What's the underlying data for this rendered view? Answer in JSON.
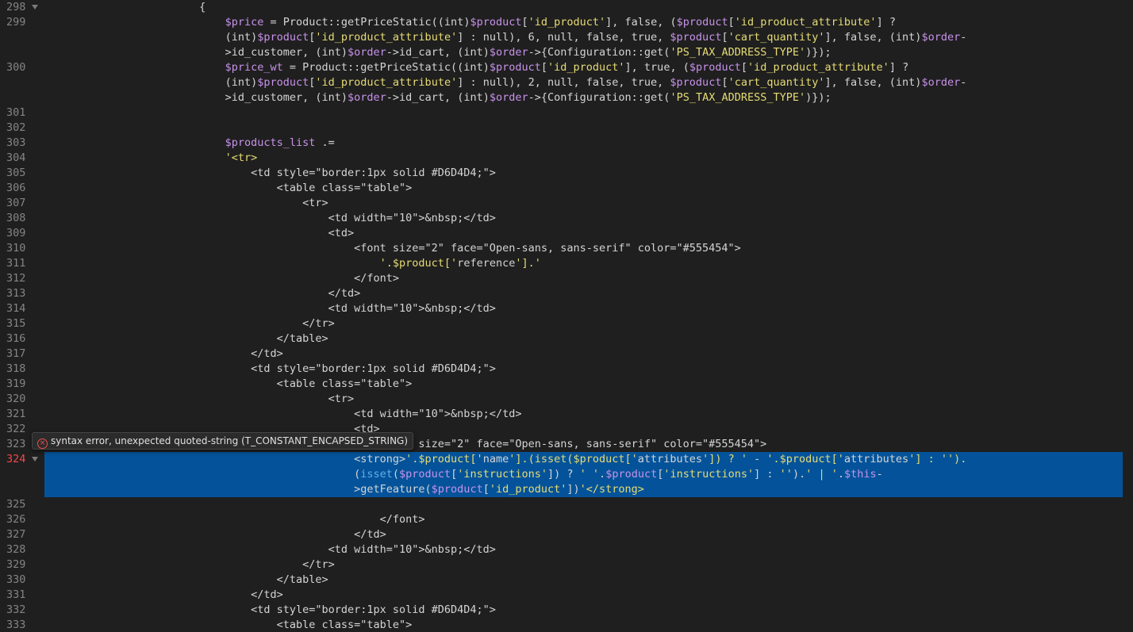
{
  "tooltip": {
    "icon": "error-circle-icon",
    "message": "syntax error, unexpected quoted-string (T_CONSTANT_ENCAPSED_STRING)"
  },
  "colors": {
    "background": "#1f1f1f",
    "selection": "#04539a",
    "line_number": "#858585",
    "error_line_number": "#f44747",
    "variable": "#c792ea",
    "string": "#e6db74",
    "keyword": "#61afef",
    "number": "#f78c6c"
  },
  "lines": [
    {
      "n": "298",
      "fold": true,
      "text": "                        {"
    },
    {
      "n": "299",
      "text": "                            $price = Product::getPriceStatic((int)$product['id_product'], false, ($product['id_product_attribute'] ?"
    },
    {
      "n": "",
      "text": "                            (int)$product['id_product_attribute'] : null), 6, null, false, true, $product['cart_quantity'], false, (int)$order-"
    },
    {
      "n": "",
      "text": "                            >id_customer, (int)$order->id_cart, (int)$order->{Configuration::get('PS_TAX_ADDRESS_TYPE')});"
    },
    {
      "n": "300",
      "text": "                            $price_wt = Product::getPriceStatic((int)$product['id_product'], true, ($product['id_product_attribute'] ?"
    },
    {
      "n": "",
      "text": "                            (int)$product['id_product_attribute'] : null), 2, null, false, true, $product['cart_quantity'], false, (int)$order-"
    },
    {
      "n": "",
      "text": "                            >id_customer, (int)$order->id_cart, (int)$order->{Configuration::get('PS_TAX_ADDRESS_TYPE')});"
    },
    {
      "n": "301",
      "text": ""
    },
    {
      "n": "302",
      "text": ""
    },
    {
      "n": "303",
      "text": "                            $products_list .="
    },
    {
      "n": "304",
      "text": "                            '<tr>"
    },
    {
      "n": "305",
      "text": "                                <td style=\"border:1px solid #D6D4D4;\">"
    },
    {
      "n": "306",
      "text": "                                    <table class=\"table\">"
    },
    {
      "n": "307",
      "text": "                                        <tr>"
    },
    {
      "n": "308",
      "text": "                                            <td width=\"10\">&nbsp;</td>"
    },
    {
      "n": "309",
      "text": "                                            <td>"
    },
    {
      "n": "310",
      "text": "                                                <font size=\"2\" face=\"Open-sans, sans-serif\" color=\"#555454\">"
    },
    {
      "n": "311",
      "text": "                                                    '.$product['reference'].'"
    },
    {
      "n": "312",
      "text": "                                                </font>"
    },
    {
      "n": "313",
      "text": "                                            </td>"
    },
    {
      "n": "314",
      "text": "                                            <td width=\"10\">&nbsp;</td>"
    },
    {
      "n": "315",
      "text": "                                        </tr>"
    },
    {
      "n": "316",
      "text": "                                    </table>"
    },
    {
      "n": "317",
      "text": "                                </td>"
    },
    {
      "n": "318",
      "text": "                                <td style=\"border:1px solid #D6D4D4;\">"
    },
    {
      "n": "319",
      "text": "                                    <table class=\"table\">"
    },
    {
      "n": "320",
      "text": "                                            <tr>"
    },
    {
      "n": "321",
      "text": "                                                <td width=\"10\">&nbsp;</td>"
    },
    {
      "n": "322",
      "text": "                                                <td>"
    },
    {
      "n": "323",
      "text": "                                                    <font size=\"2\" face=\"Open-sans, sans-serif\" color=\"#555454\">"
    },
    {
      "n": "324",
      "fold": true,
      "error": true,
      "selected": true,
      "text": "                                                <strong>'.$product['name'].(isset($product['attributes']) ? ' - '.$product['attributes'] : '')."
    },
    {
      "n": "",
      "selected": true,
      "text": "                                                (isset($product['instructions']) ? ' '.$product['instructions'] : '').' | '.$this-"
    },
    {
      "n": "",
      "selected": true,
      "text": "                                                >getFeature($product['id_product'])'</strong>"
    },
    {
      "n": "325",
      "text": ""
    },
    {
      "n": "326",
      "text": "                                                    </font>"
    },
    {
      "n": "327",
      "text": "                                                </td>"
    },
    {
      "n": "328",
      "text": "                                            <td width=\"10\">&nbsp;</td>"
    },
    {
      "n": "329",
      "text": "                                        </tr>"
    },
    {
      "n": "330",
      "text": "                                    </table>"
    },
    {
      "n": "331",
      "text": "                                </td>"
    },
    {
      "n": "332",
      "text": "                                <td style=\"border:1px solid #D6D4D4;\">"
    },
    {
      "n": "333",
      "text": "                                    <table class=\"table\">"
    }
  ]
}
